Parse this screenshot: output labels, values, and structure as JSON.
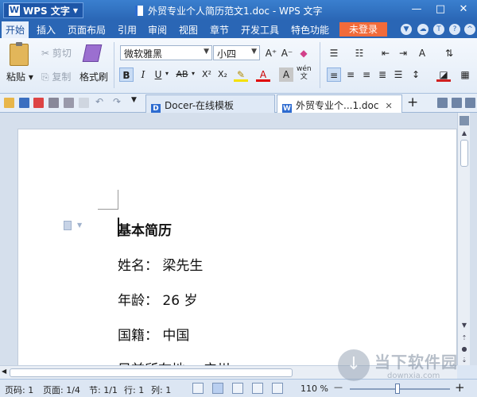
{
  "app": {
    "button_label": "WPS 文字",
    "logo_letter": "W"
  },
  "window": {
    "title": "外贸专业个人简历范文1.doc - WPS 文字"
  },
  "window_controls": {
    "minimize": "—",
    "maximize": "□",
    "close": "✕"
  },
  "menu": {
    "items": [
      "开始",
      "插入",
      "页面布局",
      "引用",
      "审阅",
      "视图",
      "章节",
      "开发工具",
      "特色功能"
    ],
    "active_index": 0,
    "login_label": "未登录"
  },
  "ribbon": {
    "paste_label": "粘贴",
    "cut_label": "剪切",
    "copy_label": "复制",
    "format_painter_label": "格式刷",
    "font_name": "微软雅黑",
    "font_size": "小四",
    "bold": "B",
    "italic": "I",
    "underline": "U",
    "strikethrough": "AB",
    "superscript": "X²",
    "subscript": "X₂",
    "font_color_letter": "A",
    "char_shading_letter": "A",
    "pinyin_top": "wén",
    "pinyin_bottom": "文",
    "grow_font": "A⁺",
    "shrink_font": "A⁻"
  },
  "tabs": [
    {
      "label": "Docer-在线模板",
      "active": false
    },
    {
      "label": "外贸专业个...1.doc",
      "active": true
    }
  ],
  "tab_add": "+",
  "document": {
    "lines": [
      {
        "text": "基本简历",
        "bold": true
      },
      {
        "text": "姓名： 梁先生",
        "bold": false
      },
      {
        "text": "年龄： 26 岁",
        "bold": false
      },
      {
        "text": "国籍： 中国",
        "bold": false
      },
      {
        "text": "目前所在地： 广州",
        "bold": false
      }
    ]
  },
  "status": {
    "page_number": "页码: 1",
    "pages": "页面: 1/4",
    "section": "节: 1/1",
    "row": "行: 1",
    "column": "列: 1",
    "zoom": "110 %",
    "zoom_minus": "—",
    "zoom_plus": "+",
    "zoom_fraction": 0.48
  },
  "watermark": {
    "text": "当下软件园",
    "url": "downxia.com"
  }
}
